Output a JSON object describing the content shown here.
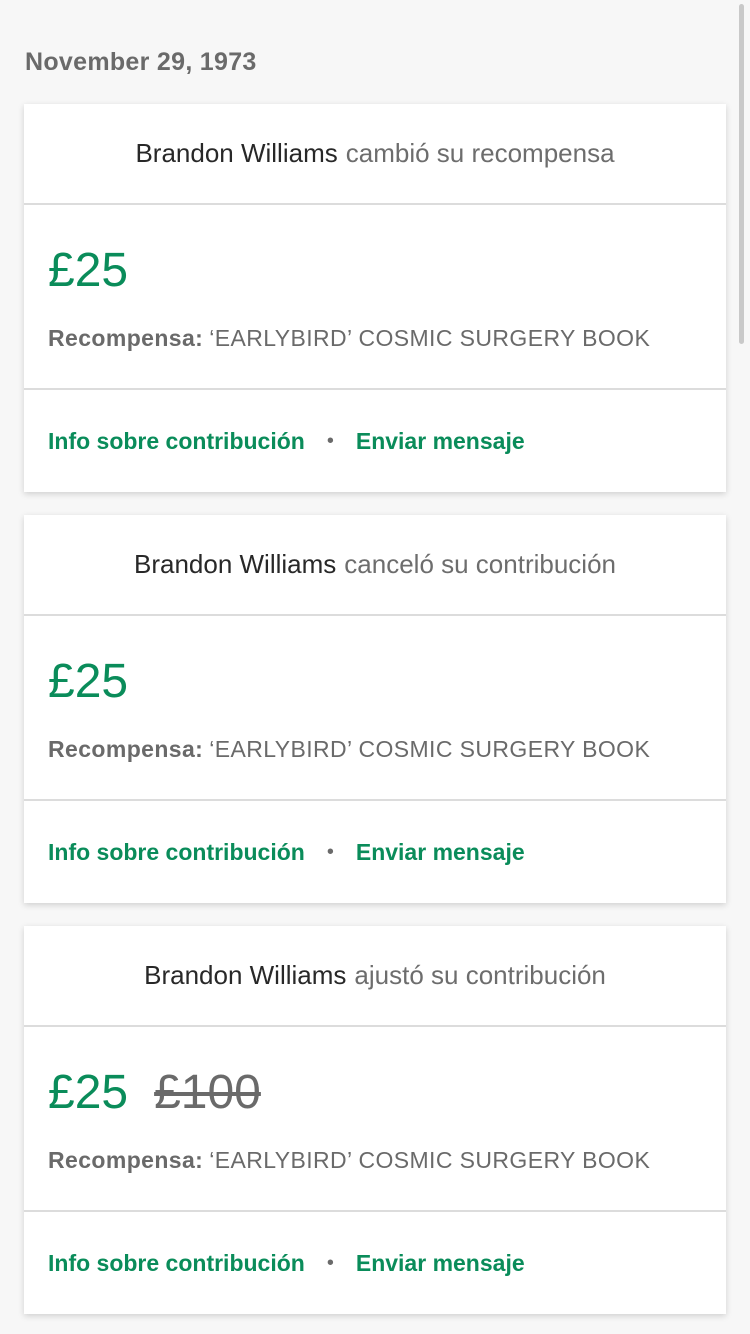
{
  "date_header": "November 29, 1973",
  "cards": [
    {
      "name": "Brandon Williams",
      "action": "cambió su recompensa",
      "amount": "£25",
      "old_amount": "",
      "reward_label": "Recompensa:",
      "reward_value": "‘EARLYBIRD’ COSMIC SURGERY BOOK",
      "link_info": "Info sobre contribución",
      "separator": "•",
      "link_message": "Enviar mensaje"
    },
    {
      "name": "Brandon Williams",
      "action": "canceló su contribución",
      "amount": "£25",
      "old_amount": "",
      "reward_label": "Recompensa:",
      "reward_value": "‘EARLYBIRD’ COSMIC SURGERY BOOK",
      "link_info": "Info sobre contribución",
      "separator": "•",
      "link_message": "Enviar mensaje"
    },
    {
      "name": "Brandon Williams",
      "action": "ajustó su contribución",
      "amount": "£25",
      "old_amount": "£100",
      "reward_label": "Recompensa:",
      "reward_value": "‘EARLYBIRD’ COSMIC SURGERY BOOK",
      "link_info": "Info sobre contribución",
      "separator": "•",
      "link_message": "Enviar mensaje"
    }
  ],
  "colors": {
    "accent": "#0a8c5a",
    "muted": "#6a6a6a",
    "background": "#f7f7f7"
  }
}
